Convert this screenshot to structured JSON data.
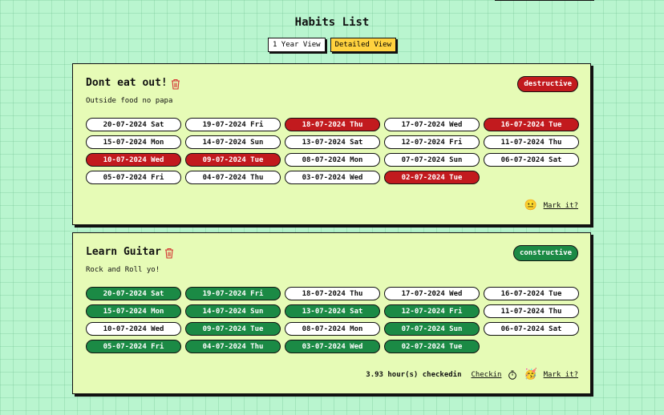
{
  "page": {
    "title": "Habits List"
  },
  "views": {
    "year": "1 Year View",
    "detailed": "Detailed View"
  },
  "colors": {
    "destructive": "#c21a1e",
    "constructive": "#1b8a45",
    "background": "#b9f5cf",
    "card": "#e6fbb6",
    "active_view": "#ffd23f"
  },
  "habits": [
    {
      "name": "Dont eat out!",
      "description": "Outside food no papa",
      "type": "destructive",
      "mark_label": "Mark it?",
      "mark_emoji": "😐",
      "days": [
        {
          "label": "20-07-2024 Sat",
          "checked": false
        },
        {
          "label": "19-07-2024 Fri",
          "checked": false
        },
        {
          "label": "18-07-2024 Thu",
          "checked": true
        },
        {
          "label": "17-07-2024 Wed",
          "checked": false
        },
        {
          "label": "16-07-2024 Tue",
          "checked": true
        },
        {
          "label": "15-07-2024 Mon",
          "checked": false
        },
        {
          "label": "14-07-2024 Sun",
          "checked": false
        },
        {
          "label": "13-07-2024 Sat",
          "checked": false
        },
        {
          "label": "12-07-2024 Fri",
          "checked": false
        },
        {
          "label": "11-07-2024 Thu",
          "checked": false
        },
        {
          "label": "10-07-2024 Wed",
          "checked": true
        },
        {
          "label": "09-07-2024 Tue",
          "checked": true
        },
        {
          "label": "08-07-2024 Mon",
          "checked": false
        },
        {
          "label": "07-07-2024 Sun",
          "checked": false
        },
        {
          "label": "06-07-2024 Sat",
          "checked": false
        },
        {
          "label": "05-07-2024 Fri",
          "checked": false
        },
        {
          "label": "04-07-2024 Thu",
          "checked": false
        },
        {
          "label": "03-07-2024 Wed",
          "checked": false
        },
        {
          "label": "02-07-2024 Tue",
          "checked": true
        }
      ]
    },
    {
      "name": "Learn Guitar",
      "description": "Rock and Roll yo!",
      "type": "constructive",
      "hours_text": "3.93 hour(s) checkedin",
      "checkin_label": "Checkin",
      "mark_label": "Mark it?",
      "mark_emoji": "🥳",
      "days": [
        {
          "label": "20-07-2024 Sat",
          "checked": true
        },
        {
          "label": "19-07-2024 Fri",
          "checked": true
        },
        {
          "label": "18-07-2024 Thu",
          "checked": false
        },
        {
          "label": "17-07-2024 Wed",
          "checked": false
        },
        {
          "label": "16-07-2024 Tue",
          "checked": false
        },
        {
          "label": "15-07-2024 Mon",
          "checked": true
        },
        {
          "label": "14-07-2024 Sun",
          "checked": true
        },
        {
          "label": "13-07-2024 Sat",
          "checked": true
        },
        {
          "label": "12-07-2024 Fri",
          "checked": true
        },
        {
          "label": "11-07-2024 Thu",
          "checked": false
        },
        {
          "label": "10-07-2024 Wed",
          "checked": false
        },
        {
          "label": "09-07-2024 Tue",
          "checked": true
        },
        {
          "label": "08-07-2024 Mon",
          "checked": false
        },
        {
          "label": "07-07-2024 Sun",
          "checked": true
        },
        {
          "label": "06-07-2024 Sat",
          "checked": false
        },
        {
          "label": "05-07-2024 Fri",
          "checked": true
        },
        {
          "label": "04-07-2024 Thu",
          "checked": true
        },
        {
          "label": "03-07-2024 Wed",
          "checked": true
        },
        {
          "label": "02-07-2024 Tue",
          "checked": true
        }
      ]
    }
  ]
}
